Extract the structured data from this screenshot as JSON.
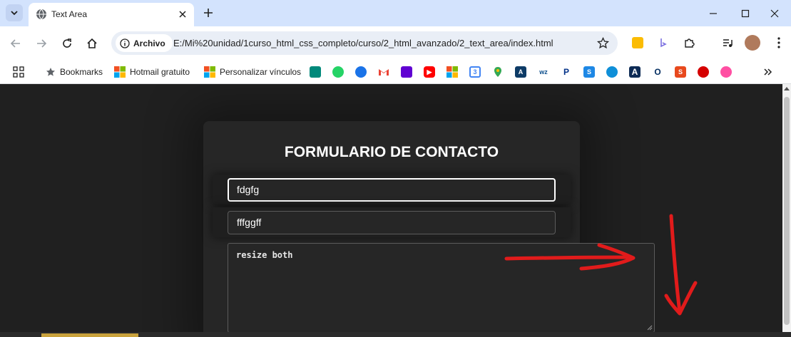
{
  "browser": {
    "tab_title": "Text Area",
    "chip_label": "Archivo",
    "url": "E:/Mi%20unidad/1curso_html_css_completo/curso/2_html_avanzado/2_text_area/index.html",
    "bookmarks": [
      {
        "label": "Bookmarks"
      },
      {
        "label": "Hotmail gratuito"
      },
      {
        "label": "Personalizar vínculos"
      }
    ]
  },
  "page": {
    "form_title": "FORMULARIO DE CONTACTO",
    "name_value": "fdgfg",
    "email_value": "fffggff",
    "message_value": "resize both"
  },
  "colors": {
    "page_bg": "#202020",
    "card_bg": "#262626",
    "annotation_red": "#e11b1b"
  }
}
